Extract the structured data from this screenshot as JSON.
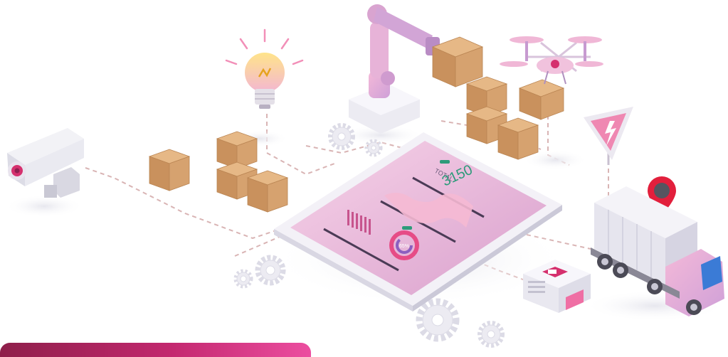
{
  "dashboard": {
    "total_label": "TOTAL",
    "total_value": "3150",
    "donut_percent": "65%"
  },
  "colors": {
    "accent": "#e9447f",
    "tablet_top": "#f7d3e8",
    "tablet_bottom": "#dca0cc",
    "box": "#d5a06c",
    "banner_start": "#8e1f4a",
    "banner_end": "#ec4ea0"
  },
  "icons": [
    "cctv-camera-icon",
    "light-bulb-icon",
    "robot-arm-icon",
    "drone-icon",
    "warning-sign-icon",
    "location-pin-icon",
    "delivery-truck-icon",
    "router-device-icon",
    "gear-icon",
    "cardboard-box-icon"
  ]
}
